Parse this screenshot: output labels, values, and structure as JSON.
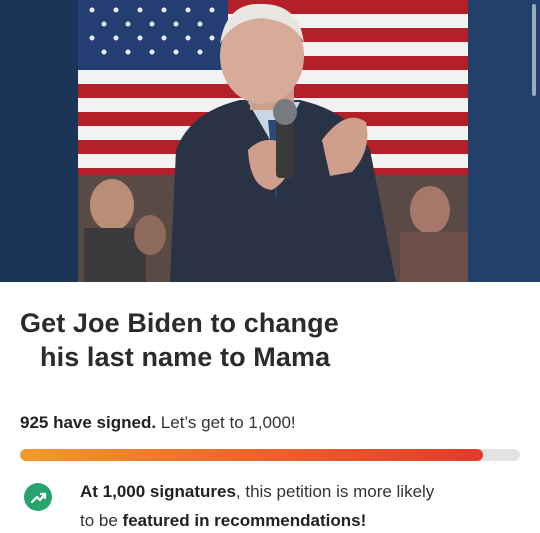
{
  "hero": {
    "image_label": "Photo of a man speaking into a microphone in front of an American flag"
  },
  "petition": {
    "title_line1": "Get Joe Biden to change",
    "title_line2": "his last name to Mama",
    "signed_count": "925 have signed.",
    "signed_goal": " Let’s get to 1,000!",
    "progress_fraction": 0.925,
    "info_bold1": "At 1,000 signatures",
    "info_text1": ", this petition is more likely",
    "info_text2": "to be ",
    "info_bold2": "featured in recommendations!"
  },
  "icons": {
    "trend": "trending-up-icon"
  },
  "colors": {
    "title": "#2b2b2b",
    "progress_start": "#f29a2e",
    "progress_end": "#e23a2a",
    "progress_track": "#e3e3e3",
    "trend_badge": "#28a36b"
  }
}
